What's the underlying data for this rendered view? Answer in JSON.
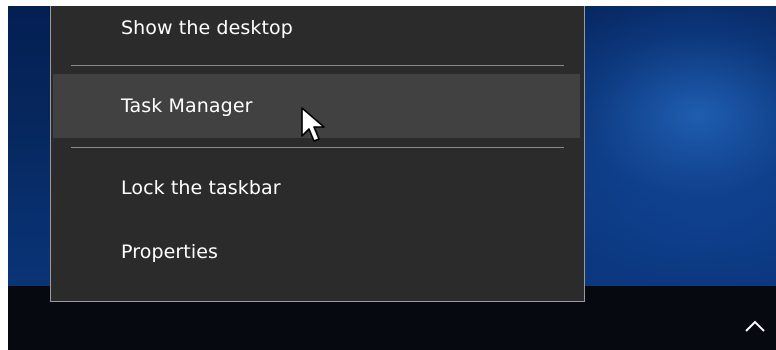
{
  "context_menu": {
    "items": [
      {
        "label": "Show the desktop"
      },
      {
        "label": "Task Manager",
        "highlighted": true
      },
      {
        "label": "Lock the taskbar"
      },
      {
        "label": "Properties"
      }
    ]
  },
  "taskbar": {
    "tray_icon": "chevron-up-icon"
  },
  "pointer": {
    "icon": "mouse-pointer-icon"
  },
  "colors": {
    "menu_background": "#2b2b2b",
    "menu_highlight": "#414141",
    "menu_text": "#ffffff",
    "separator": "#8a8a8a",
    "taskbar": "#06090f",
    "desktop_blue": "#0d3c88"
  }
}
